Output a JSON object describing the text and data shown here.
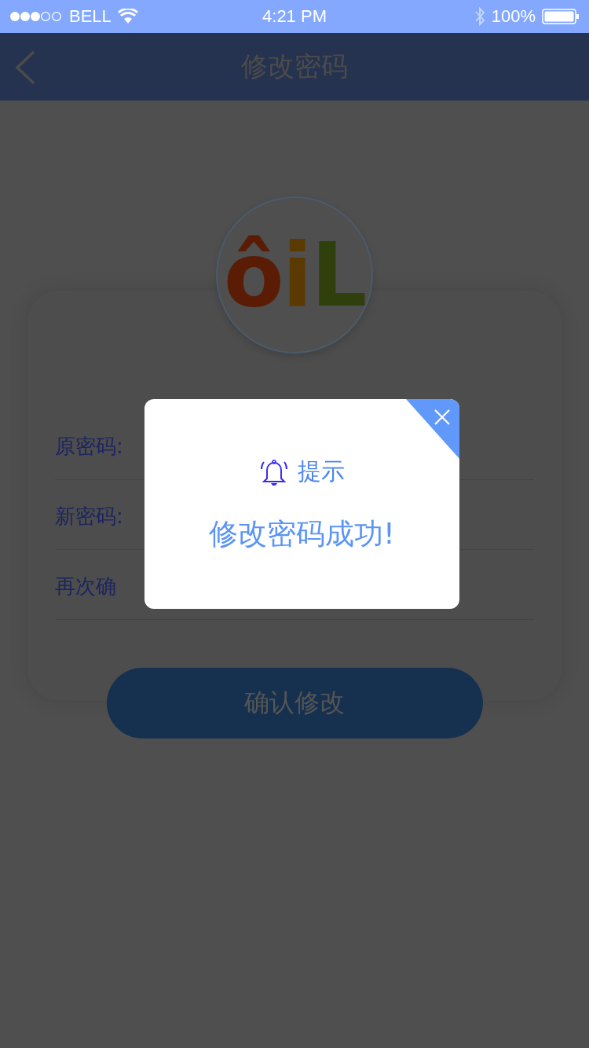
{
  "status_bar": {
    "carrier": "BELL",
    "time": "4:21 PM",
    "battery": "100%"
  },
  "nav": {
    "title": "修改密码"
  },
  "logo": {
    "letters": [
      {
        "text": "ô",
        "color": "#5a1c05"
      },
      {
        "text": "i",
        "color": "#5a3a00"
      },
      {
        "text": "L",
        "color": "#30400c"
      }
    ]
  },
  "form": {
    "fields": [
      {
        "label": "原密码:"
      },
      {
        "label": "新密码:"
      },
      {
        "label": "再次确"
      }
    ]
  },
  "submit_button": "确认修改",
  "dialog": {
    "title": "提示",
    "message": "修改密码成功!"
  }
}
